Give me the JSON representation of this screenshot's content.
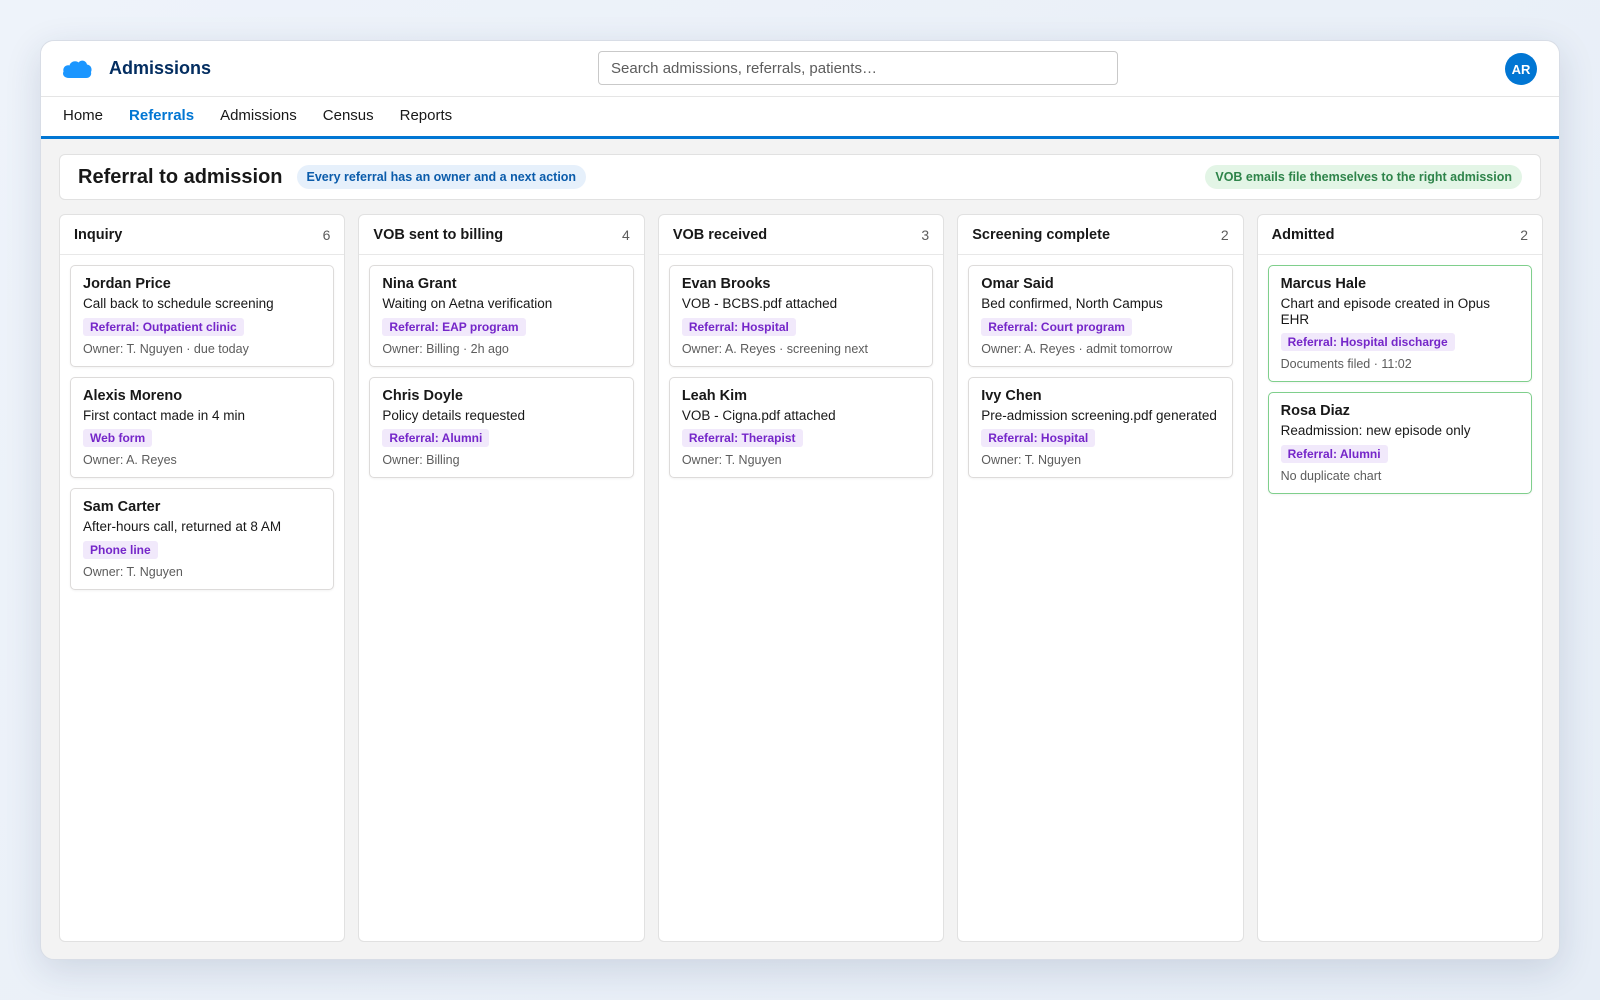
{
  "app": {
    "title": "Admissions",
    "logo_icon": "cloud-icon",
    "search_placeholder": "Search admissions, referrals, patients…",
    "avatar_initials": "AR",
    "accent": "#0176d3"
  },
  "nav": {
    "tabs": [
      {
        "label": "Home",
        "active": false
      },
      {
        "label": "Referrals",
        "active": true
      },
      {
        "label": "Admissions",
        "active": false
      },
      {
        "label": "Census",
        "active": false
      },
      {
        "label": "Reports",
        "active": false
      }
    ]
  },
  "header": {
    "title": "Referral to admission",
    "badge_left": "Every referral has an owner and a next action",
    "badge_right": "VOB emails file themselves to the right admission"
  },
  "columns": [
    {
      "title": "Inquiry",
      "count": "6",
      "cards": [
        {
          "name": "Jordan Price",
          "status": "Call back to schedule screening",
          "tag": "Referral: Outpatient clinic",
          "meta": "Owner: T. Nguyen · due today"
        },
        {
          "name": "Alexis Moreno",
          "status": "First contact made in 4 min",
          "tag": "Web form",
          "meta": "Owner: A. Reyes"
        },
        {
          "name": "Sam Carter",
          "status": "After-hours call, returned at 8 AM",
          "tag": "Phone line",
          "meta": "Owner: T. Nguyen"
        }
      ]
    },
    {
      "title": "VOB sent to billing",
      "count": "4",
      "cards": [
        {
          "name": "Nina Grant",
          "status": "Waiting on Aetna verification",
          "tag": "Referral: EAP program",
          "meta": "Owner: Billing · 2h ago"
        },
        {
          "name": "Chris Doyle",
          "status": "Policy details requested",
          "tag": "Referral: Alumni",
          "meta": "Owner: Billing"
        }
      ]
    },
    {
      "title": "VOB received",
      "count": "3",
      "cards": [
        {
          "name": "Evan Brooks",
          "status": "VOB - BCBS.pdf attached",
          "tag": "Referral: Hospital",
          "meta": "Owner: A. Reyes · screening next"
        },
        {
          "name": "Leah Kim",
          "status": "VOB - Cigna.pdf attached",
          "tag": "Referral: Therapist",
          "meta": "Owner: T. Nguyen"
        }
      ]
    },
    {
      "title": "Screening complete",
      "count": "2",
      "cards": [
        {
          "name": "Omar Said",
          "status": "Bed confirmed, North Campus",
          "tag": "Referral: Court program",
          "meta": "Owner: A. Reyes · admit tomorrow"
        },
        {
          "name": "Ivy Chen",
          "status": "Pre-admission screening.pdf generated",
          "tag": "Referral: Hospital",
          "meta": "Owner: T. Nguyen"
        }
      ]
    },
    {
      "title": "Admitted",
      "count": "2",
      "cards": [
        {
          "name": "Marcus Hale",
          "status": "Chart and episode created in Opus EHR",
          "tag": "Referral: Hospital discharge",
          "meta": "Documents filed · 11:02",
          "highlight": true
        },
        {
          "name": "Rosa Diaz",
          "status": "Readmission: new episode only",
          "tag": "Referral: Alumni",
          "meta": "No duplicate chart",
          "highlight": true
        }
      ]
    }
  ]
}
